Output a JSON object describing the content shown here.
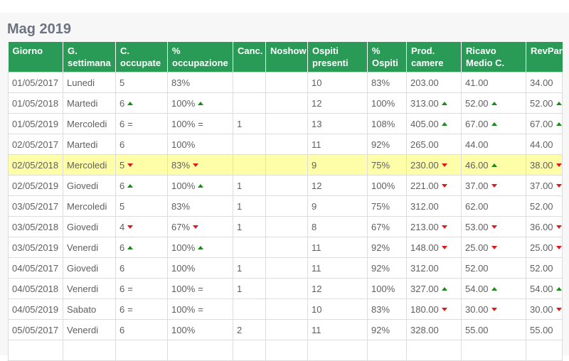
{
  "title": "Mag 2019",
  "colors": {
    "header_bg": "#2a9b56",
    "highlight": "#fefea8",
    "up": "#1a8a1a",
    "down": "#e01a1a"
  },
  "columns": [
    {
      "key": "giorno",
      "label": "Giorno"
    },
    {
      "key": "gsett",
      "label": "G. settimana"
    },
    {
      "key": "cocc",
      "label": "C. occupate"
    },
    {
      "key": "pocc",
      "label": "% occupazione"
    },
    {
      "key": "canc",
      "label": "Canc."
    },
    {
      "key": "noshow",
      "label": "Noshow"
    },
    {
      "key": "ospiti",
      "label": "Ospiti presenti"
    },
    {
      "key": "posp",
      "label": "% Ospiti"
    },
    {
      "key": "prod",
      "label": "Prod. camere"
    },
    {
      "key": "ricavo",
      "label": "Ricavo Medio C."
    },
    {
      "key": "revpar",
      "label": "RevPar"
    }
  ],
  "rows": [
    {
      "highlight": false,
      "cells": [
        {
          "v": "01/05/2017"
        },
        {
          "v": "Lunedi"
        },
        {
          "v": "5"
        },
        {
          "v": "83%"
        },
        {
          "v": ""
        },
        {
          "v": ""
        },
        {
          "v": "10"
        },
        {
          "v": "83%"
        },
        {
          "v": "203.00"
        },
        {
          "v": "41.00"
        },
        {
          "v": "34.00"
        }
      ]
    },
    {
      "highlight": false,
      "cells": [
        {
          "v": "01/05/2018"
        },
        {
          "v": "Martedi"
        },
        {
          "v": "6",
          "t": "up"
        },
        {
          "v": "100%",
          "t": "up"
        },
        {
          "v": ""
        },
        {
          "v": ""
        },
        {
          "v": "12"
        },
        {
          "v": "100%"
        },
        {
          "v": "313.00",
          "t": "up"
        },
        {
          "v": "52.00",
          "t": "up"
        },
        {
          "v": "52.00",
          "t": "up"
        }
      ]
    },
    {
      "highlight": false,
      "cells": [
        {
          "v": "01/05/2019"
        },
        {
          "v": "Mercoledi"
        },
        {
          "v": "6",
          "t": "eq"
        },
        {
          "v": "100%",
          "t": "eq"
        },
        {
          "v": "1"
        },
        {
          "v": ""
        },
        {
          "v": "13"
        },
        {
          "v": "108%"
        },
        {
          "v": "405.00",
          "t": "up"
        },
        {
          "v": "67.00",
          "t": "up"
        },
        {
          "v": "67.00",
          "t": "up"
        }
      ]
    },
    {
      "highlight": false,
      "cells": [
        {
          "v": "02/05/2017"
        },
        {
          "v": "Martedi"
        },
        {
          "v": "6"
        },
        {
          "v": "100%"
        },
        {
          "v": ""
        },
        {
          "v": ""
        },
        {
          "v": "11"
        },
        {
          "v": "92%"
        },
        {
          "v": "265.00"
        },
        {
          "v": "44.00"
        },
        {
          "v": "44.00"
        }
      ]
    },
    {
      "highlight": true,
      "cells": [
        {
          "v": "02/05/2018"
        },
        {
          "v": "Mercoledi"
        },
        {
          "v": "5",
          "t": "down"
        },
        {
          "v": "83%",
          "t": "down"
        },
        {
          "v": ""
        },
        {
          "v": ""
        },
        {
          "v": "9"
        },
        {
          "v": "75%"
        },
        {
          "v": "230.00",
          "t": "down"
        },
        {
          "v": "46.00",
          "t": "up"
        },
        {
          "v": "38.00",
          "t": "down"
        }
      ]
    },
    {
      "highlight": false,
      "cells": [
        {
          "v": "02/05/2019"
        },
        {
          "v": "Giovedi"
        },
        {
          "v": "6",
          "t": "up"
        },
        {
          "v": "100%",
          "t": "up"
        },
        {
          "v": "1"
        },
        {
          "v": ""
        },
        {
          "v": "12"
        },
        {
          "v": "100%"
        },
        {
          "v": "221.00",
          "t": "down"
        },
        {
          "v": "37.00",
          "t": "down"
        },
        {
          "v": "37.00",
          "t": "down"
        }
      ]
    },
    {
      "highlight": false,
      "cells": [
        {
          "v": "03/05/2017"
        },
        {
          "v": "Mercoledi"
        },
        {
          "v": "5"
        },
        {
          "v": "83%"
        },
        {
          "v": "1"
        },
        {
          "v": ""
        },
        {
          "v": "9"
        },
        {
          "v": "75%"
        },
        {
          "v": "312.00"
        },
        {
          "v": "62.00"
        },
        {
          "v": "52.00"
        }
      ]
    },
    {
      "highlight": false,
      "cells": [
        {
          "v": "03/05/2018"
        },
        {
          "v": "Giovedi"
        },
        {
          "v": "4",
          "t": "down"
        },
        {
          "v": "67%",
          "t": "down"
        },
        {
          "v": "1"
        },
        {
          "v": ""
        },
        {
          "v": "8"
        },
        {
          "v": "67%"
        },
        {
          "v": "213.00",
          "t": "down"
        },
        {
          "v": "53.00",
          "t": "down"
        },
        {
          "v": "36.00",
          "t": "down"
        }
      ]
    },
    {
      "highlight": false,
      "cells": [
        {
          "v": "03/05/2019"
        },
        {
          "v": "Venerdi"
        },
        {
          "v": "6",
          "t": "up"
        },
        {
          "v": "100%",
          "t": "up"
        },
        {
          "v": ""
        },
        {
          "v": ""
        },
        {
          "v": "11"
        },
        {
          "v": "92%"
        },
        {
          "v": "148.00",
          "t": "down"
        },
        {
          "v": "25.00",
          "t": "down"
        },
        {
          "v": "25.00",
          "t": "down"
        }
      ]
    },
    {
      "highlight": false,
      "cells": [
        {
          "v": "04/05/2017"
        },
        {
          "v": "Giovedi"
        },
        {
          "v": "6"
        },
        {
          "v": "100%"
        },
        {
          "v": "1"
        },
        {
          "v": ""
        },
        {
          "v": "11"
        },
        {
          "v": "92%"
        },
        {
          "v": "312.00"
        },
        {
          "v": "52.00"
        },
        {
          "v": "52.00"
        }
      ]
    },
    {
      "highlight": false,
      "cells": [
        {
          "v": "04/05/2018"
        },
        {
          "v": "Venerdi"
        },
        {
          "v": "6",
          "t": "eq"
        },
        {
          "v": "100%",
          "t": "eq"
        },
        {
          "v": "1"
        },
        {
          "v": ""
        },
        {
          "v": "12"
        },
        {
          "v": "100%"
        },
        {
          "v": "327.00",
          "t": "up"
        },
        {
          "v": "54.00",
          "t": "up"
        },
        {
          "v": "54.00",
          "t": "up"
        }
      ]
    },
    {
      "highlight": false,
      "cells": [
        {
          "v": "04/05/2019"
        },
        {
          "v": "Sabato"
        },
        {
          "v": "6",
          "t": "eq"
        },
        {
          "v": "100%",
          "t": "eq"
        },
        {
          "v": ""
        },
        {
          "v": ""
        },
        {
          "v": "10"
        },
        {
          "v": "83%"
        },
        {
          "v": "180.00",
          "t": "down"
        },
        {
          "v": "30.00",
          "t": "down"
        },
        {
          "v": "30.00",
          "t": "down"
        }
      ]
    },
    {
      "highlight": false,
      "cells": [
        {
          "v": "05/05/2017"
        },
        {
          "v": "Venerdi"
        },
        {
          "v": "6"
        },
        {
          "v": "100%"
        },
        {
          "v": "2"
        },
        {
          "v": ""
        },
        {
          "v": "11"
        },
        {
          "v": "92%"
        },
        {
          "v": "328.00"
        },
        {
          "v": "55.00"
        },
        {
          "v": "55.00"
        }
      ]
    },
    {
      "highlight": false,
      "cells": [
        {
          "v": ""
        },
        {
          "v": ""
        },
        {
          "v": ""
        },
        {
          "v": ""
        },
        {
          "v": ""
        },
        {
          "v": ""
        },
        {
          "v": ""
        },
        {
          "v": ""
        },
        {
          "v": ""
        },
        {
          "v": ""
        },
        {
          "v": ""
        }
      ]
    }
  ]
}
